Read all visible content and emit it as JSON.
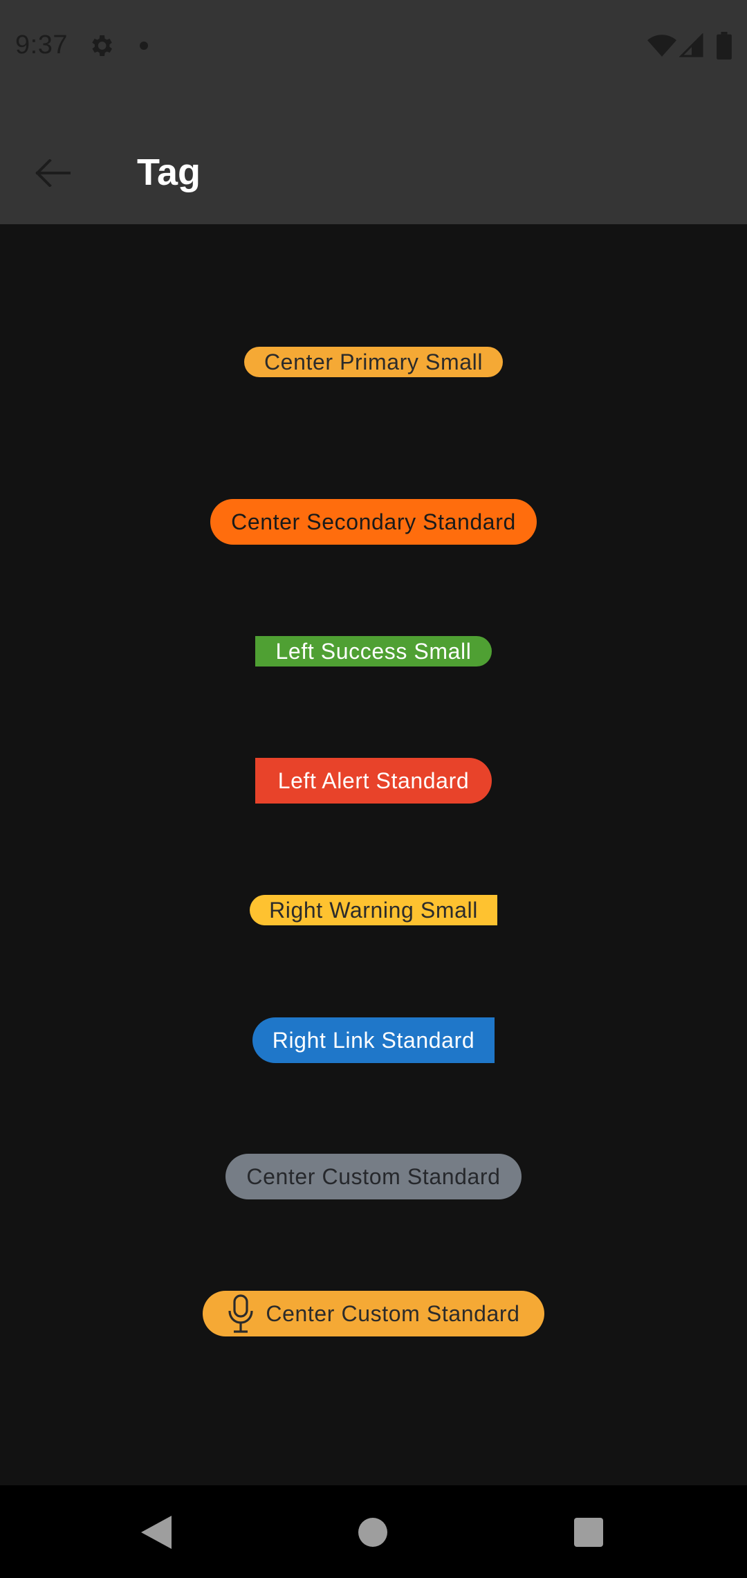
{
  "status_bar": {
    "time": "9:37",
    "icons": [
      "gear-icon",
      "notification-dot-icon",
      "wifi-icon",
      "signal-icon",
      "battery-icon"
    ]
  },
  "app_bar": {
    "title": "Tag",
    "back_icon": "arrow-left-icon"
  },
  "tags": [
    {
      "label": "Center Primary Small",
      "shape": "center",
      "size": "small",
      "background": "#f5a935",
      "text_color": "#2b2b2b"
    },
    {
      "label": "Center Secondary Standard",
      "shape": "center",
      "size": "standard",
      "background": "#ff6d0d",
      "text_color": "#1a1a1a"
    },
    {
      "label": "Left Success Small",
      "shape": "left",
      "size": "small",
      "background": "#4fa033",
      "text_color": "#ffffff"
    },
    {
      "label": "Left Alert Standard",
      "shape": "left",
      "size": "standard",
      "background": "#e8432a",
      "text_color": "#ffffff"
    },
    {
      "label": "Right Warning Small",
      "shape": "right",
      "size": "small",
      "background": "#fec230",
      "text_color": "#2b2b2b"
    },
    {
      "label": "Right Link Standard",
      "shape": "right",
      "size": "standard",
      "background": "#1f77c9",
      "text_color": "#ffffff"
    },
    {
      "label": "Center Custom Standard",
      "shape": "center",
      "size": "standard",
      "background": "#767d86",
      "text_color": "#26282c"
    },
    {
      "label": "Center Custom Standard",
      "shape": "center",
      "size": "standard",
      "background": "#f5a935",
      "text_color": "#2b2b2b",
      "icon": "microphone-icon"
    }
  ],
  "nav_bar": {
    "icons": [
      "nav-back-icon",
      "nav-home-icon",
      "nav-recents-icon"
    ]
  }
}
